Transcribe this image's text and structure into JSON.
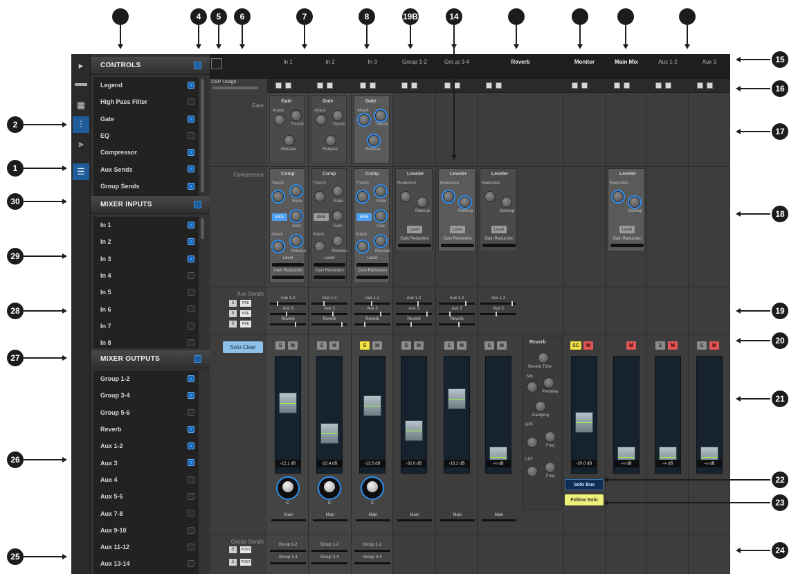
{
  "callouts": {
    "top": [
      {
        "id": "c-top-controls",
        "label": ""
      },
      {
        "id": "c4",
        "label": "4"
      },
      {
        "id": "c5",
        "label": "5"
      },
      {
        "id": "c6",
        "label": "6"
      },
      {
        "id": "c7",
        "label": "7"
      },
      {
        "id": "c8",
        "label": "8"
      },
      {
        "id": "c19b",
        "label": "19B"
      },
      {
        "id": "c14",
        "label": "14"
      },
      {
        "id": "c-reverb",
        "label": ""
      },
      {
        "id": "c-monitor",
        "label": ""
      },
      {
        "id": "c-mainmix",
        "label": ""
      },
      {
        "id": "c-aux12",
        "label": ""
      }
    ],
    "left": [
      "2",
      "1",
      "30",
      "29",
      "28",
      "27",
      "26",
      "25"
    ],
    "right": [
      "15",
      "16",
      "17",
      "18",
      "19",
      "20",
      "21",
      "22",
      "23",
      "24"
    ]
  },
  "sidebar": {
    "controls_title": "CONTROLS",
    "controls": [
      {
        "label": "Legend",
        "on": true
      },
      {
        "label": "High Pass Filter",
        "on": false
      },
      {
        "label": "Gate",
        "on": true
      },
      {
        "label": "EQ",
        "on": false
      },
      {
        "label": "Compressor",
        "on": true
      },
      {
        "label": "Aux Sends",
        "on": true
      },
      {
        "label": "Group Sends",
        "on": true
      }
    ],
    "inputs_title": "MIXER INPUTS",
    "inputs": [
      {
        "label": "In 1",
        "on": true
      },
      {
        "label": "In 2",
        "on": true
      },
      {
        "label": "In 3",
        "on": true
      },
      {
        "label": "In 4",
        "on": false
      },
      {
        "label": "In 5",
        "on": false
      },
      {
        "label": "In 6",
        "on": false
      },
      {
        "label": "In 7",
        "on": false
      },
      {
        "label": "In 8",
        "on": false
      }
    ],
    "outputs_title": "MIXER OUTPUTS",
    "outputs": [
      {
        "label": "Group 1-2",
        "on": true
      },
      {
        "label": "Group 3-4",
        "on": true
      },
      {
        "label": "Group 5-6",
        "on": false
      },
      {
        "label": "Reverb",
        "on": true
      },
      {
        "label": "Aux 1-2",
        "on": true
      },
      {
        "label": "Aux 3",
        "on": true
      },
      {
        "label": "Aux 4",
        "on": false
      },
      {
        "label": "Aux 5-6",
        "on": false
      },
      {
        "label": "Aux 7-8",
        "on": false
      },
      {
        "label": "Aux 9-10",
        "on": false
      },
      {
        "label": "Aux 11-12",
        "on": false
      },
      {
        "label": "Aux 13-14",
        "on": false
      }
    ]
  },
  "mixer": {
    "dsp_label": "DSP Usage:",
    "row_labels": {
      "gate": "Gate",
      "compressor": "Compressor",
      "aux_sends": "Aux Sends",
      "group_sends": "Group Sends"
    },
    "solo_clear": "Solo Clear",
    "channels": [
      {
        "name": "In 1",
        "bold": false
      },
      {
        "name": "In 2",
        "bold": false
      },
      {
        "name": "In 3",
        "bold": false
      },
      {
        "name": "Group 1-2",
        "bold": false
      },
      {
        "name": "Group 3-4",
        "bold": false
      },
      {
        "name": "Reverb",
        "bold": true
      },
      {
        "name": "Monitor",
        "bold": true
      },
      {
        "name": "Main Mix",
        "bold": true
      },
      {
        "name": "Aux 1-2",
        "bold": false
      },
      {
        "name": "Aux 3",
        "bold": false
      }
    ],
    "gate": {
      "title": "Gate",
      "knobs": [
        "Attack",
        "Thresh",
        "Release"
      ]
    },
    "comp": {
      "title": "Comp",
      "knobs": [
        "Thresh",
        "Ratio",
        "Gain",
        "Attack",
        "Release"
      ],
      "mode_button": "MKE",
      "level": "Level",
      "gain_reduction": "Gain Reduction"
    },
    "leveler": {
      "title": "Leveler",
      "reduction": "Reduction",
      "makeup": "Makeup",
      "level": "Level",
      "gain_reduction": "Gain Reduction"
    },
    "sends": [
      "Aux 1-2",
      "Aux 3",
      "Reverb"
    ],
    "group_sends": [
      "Group 1-2",
      "Group 3-4"
    ],
    "db_values": [
      "-12.1 dB",
      "-32.4 dB",
      "-13.5 dB",
      "-32.0 dB",
      "-16.2 dB",
      "-∞ dB",
      "-20.0 dB",
      "-∞ dB",
      "-∞ dB",
      "-∞ dB"
    ],
    "pan_label": "C",
    "main_label": "Main",
    "solo": "S",
    "mute": "M",
    "sc": "SC",
    "reverb_params": {
      "title": "Reverb",
      "time": "Reverb Time",
      "mix": "Mix",
      "predelay": "Predelay",
      "damp": "Damping",
      "hpf": "HPF",
      "lpf": "LPF",
      "freq1": "Freq",
      "freq2": "Freq"
    },
    "solo_bus": "Solo Bus",
    "follow_solo": "Follow Solo",
    "tb_labels": {
      "pre": "PRE",
      "pre2": "POST"
    }
  }
}
